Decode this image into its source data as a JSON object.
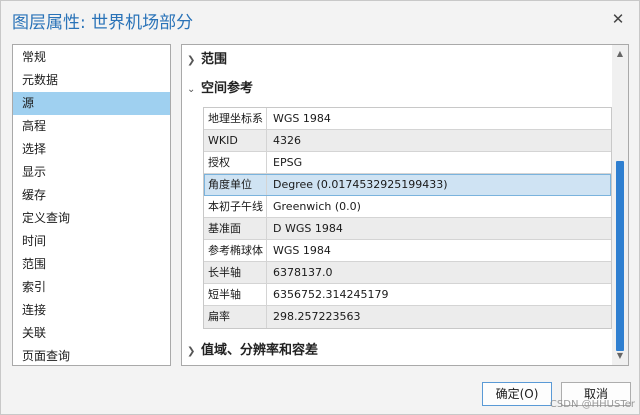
{
  "window": {
    "title": "图层属性: 世界机场部分",
    "close_glyph": "✕"
  },
  "nav": {
    "items": [
      {
        "label": "常规",
        "selected": false
      },
      {
        "label": "元数据",
        "selected": false
      },
      {
        "label": "源",
        "selected": true
      },
      {
        "label": "高程",
        "selected": false
      },
      {
        "label": "选择",
        "selected": false
      },
      {
        "label": "显示",
        "selected": false
      },
      {
        "label": "缓存",
        "selected": false
      },
      {
        "label": "定义查询",
        "selected": false
      },
      {
        "label": "时间",
        "selected": false
      },
      {
        "label": "范围",
        "selected": false
      },
      {
        "label": "索引",
        "selected": false
      },
      {
        "label": "连接",
        "selected": false
      },
      {
        "label": "关联",
        "selected": false
      },
      {
        "label": "页面查询",
        "selected": false
      }
    ]
  },
  "content": {
    "sections": {
      "extent": {
        "label": "范围",
        "expanded": false
      },
      "spatial_ref": {
        "label": "空间参考",
        "expanded": true
      },
      "domain": {
        "label": "值域、分辨率和容差",
        "expanded": false
      }
    },
    "chevrons": {
      "collapsed": "❯",
      "expanded": "⌄"
    },
    "properties": [
      {
        "key": "地理坐标系",
        "value": "WGS 1984"
      },
      {
        "key": "WKID",
        "value": "4326"
      },
      {
        "key": "授权",
        "value": "EPSG"
      },
      {
        "key": "角度单位",
        "value": "Degree (0.0174532925199433)"
      },
      {
        "key": "本初子午线",
        "value": "Greenwich (0.0)"
      },
      {
        "key": "基准面",
        "value": "D WGS 1984"
      },
      {
        "key": "参考椭球体",
        "value": "WGS 1984"
      },
      {
        "key": "长半轴",
        "value": "6378137.0"
      },
      {
        "key": "短半轴",
        "value": "6356752.314245179"
      },
      {
        "key": "扁率",
        "value": "298.257223563"
      }
    ],
    "highlighted_row": 3
  },
  "scrollbar": {
    "up_glyph": "▲",
    "down_glyph": "▼",
    "thumb_color": "#2f7fd0"
  },
  "buttons": {
    "ok_label": "确定(O)",
    "cancel_label": "取消"
  },
  "watermark": "CSDN @HHUSTer",
  "colors": {
    "title": "#2a73b8",
    "nav_selected": "#9fd0f0",
    "row_highlight": "#cfe3f3"
  }
}
